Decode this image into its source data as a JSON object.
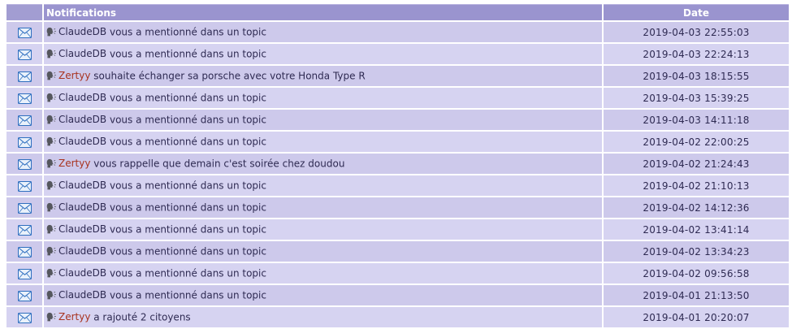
{
  "header": {
    "icon_col": "",
    "notifications_label": "Notifications",
    "date_label": "Date"
  },
  "rows": [
    {
      "user": "ClaudeDB",
      "user_highlight": false,
      "text": " vous a mentionné dans un topic",
      "date": "2019-04-03 22:55:03"
    },
    {
      "user": "ClaudeDB",
      "user_highlight": false,
      "text": " vous a mentionné dans un topic",
      "date": "2019-04-03 22:24:13"
    },
    {
      "user": "Zertyy",
      "user_highlight": true,
      "text": " souhaite échanger sa porsche avec votre Honda Type R",
      "date": "2019-04-03 18:15:55"
    },
    {
      "user": "ClaudeDB",
      "user_highlight": false,
      "text": " vous a mentionné dans un topic",
      "date": "2019-04-03 15:39:25"
    },
    {
      "user": "ClaudeDB",
      "user_highlight": false,
      "text": " vous a mentionné dans un topic",
      "date": "2019-04-03 14:11:18"
    },
    {
      "user": "ClaudeDB",
      "user_highlight": false,
      "text": " vous a mentionné dans un topic",
      "date": "2019-04-02 22:00:25"
    },
    {
      "user": "Zertyy",
      "user_highlight": true,
      "text": " vous rappelle que demain c'est soirée chez doudou",
      "date": "2019-04-02 21:24:43"
    },
    {
      "user": "ClaudeDB",
      "user_highlight": false,
      "text": " vous a mentionné dans un topic",
      "date": "2019-04-02 21:10:13"
    },
    {
      "user": "ClaudeDB",
      "user_highlight": false,
      "text": " vous a mentionné dans un topic",
      "date": "2019-04-02 14:12:36"
    },
    {
      "user": "ClaudeDB",
      "user_highlight": false,
      "text": " vous a mentionné dans un topic",
      "date": "2019-04-02 13:41:14"
    },
    {
      "user": "ClaudeDB",
      "user_highlight": false,
      "text": " vous a mentionné dans un topic",
      "date": "2019-04-02 13:34:23"
    },
    {
      "user": "ClaudeDB",
      "user_highlight": false,
      "text": " vous a mentionné dans un topic",
      "date": "2019-04-02 09:56:58"
    },
    {
      "user": "ClaudeDB",
      "user_highlight": false,
      "text": " vous a mentionné dans un topic",
      "date": "2019-04-01 21:13:50"
    },
    {
      "user": "Zertyy",
      "user_highlight": true,
      "text": " a rajouté 2 citoyens",
      "date": "2019-04-01 20:20:07"
    }
  ],
  "icons": {
    "row_icon": "envelope-icon",
    "message_icon": "speaking-head-icon"
  },
  "colors": {
    "header_bg": "#9a94cf",
    "row_odd": "#cdc9eb",
    "row_even": "#d6d3f1",
    "text": "#2e2a52",
    "user_highlight": "#a8331f",
    "envelope": "#2f6fbf"
  }
}
